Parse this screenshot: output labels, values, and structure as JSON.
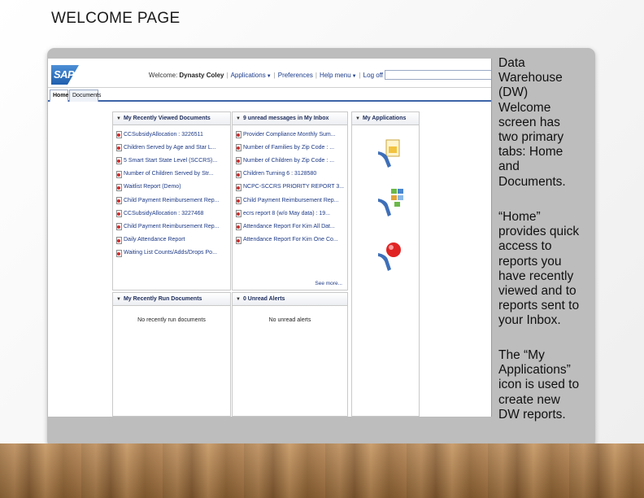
{
  "slide": {
    "title": "WELCOME PAGE",
    "paragraphs": [
      [
        "Data",
        "Warehouse",
        "(DW)",
        "Welcome",
        "screen has",
        "two  primary",
        "tabs:  Home",
        "and",
        "Documents."
      ],
      [
        "“Home”",
        "provides quick",
        "access to",
        "reports you",
        "have recently",
        "viewed and to",
        "reports sent to",
        "your Inbox."
      ],
      [
        "The “My",
        "Applications”",
        "icon is used to",
        "create new",
        "DW  reports."
      ]
    ]
  },
  "app": {
    "logo_text": "SAP",
    "colors": {
      "logo_blue": "#1f5fad",
      "tab_accent": "#3e64a8",
      "link": "#1d3a86"
    },
    "header": {
      "welcome": "Welcome:",
      "user": "Dynasty Coley",
      "applications": "Applications",
      "preferences": "Preferences",
      "help": "Help menu",
      "logoff": "Log off"
    },
    "tabs": [
      {
        "label": "Home",
        "active": true
      },
      {
        "label": "Documents",
        "active": false
      }
    ],
    "panels": {
      "recently_viewed": {
        "title": "My Recently Viewed Documents",
        "items": [
          "CCSubsidyAllocation : 3226511",
          "Children Served by Age and Star L...",
          "5 Smart Start State Level (SCCRS)...",
          "Number of Children Served by Str...",
          "Waitlist Report (Demo)",
          "Child Payment Reimbursement Rep...",
          "CCSubsidyAllocation : 3227468",
          "Child Payment Reimbursement Rep...",
          "Daily Attendance Report",
          "Waiting List Counts/Adds/Drops Po..."
        ]
      },
      "inbox": {
        "title": "9 unread messages in My Inbox",
        "items": [
          "Provider Compliance Monthly Sum...",
          "Number of Families by Zip Code : ...",
          "Number of Children by Zip Code : ...",
          "Children Turning 6 : 3128580",
          "NCPC-SCCRS PRIORITY REPORT 3...",
          "Child Payment Reimbursement Rep...",
          "ecrs report 8 (w/o May data) : 19...",
          "Attendance Report For Kim All Dat...",
          "Attendance Report For Kim One Co..."
        ],
        "see_more": "See more..."
      },
      "applications": {
        "title": "My Applications",
        "icons": [
          "web-intelligence-app-icon",
          "dashboard-app-icon",
          "explorer-app-icon"
        ]
      },
      "recently_run": {
        "title": "My Recently Run Documents",
        "empty": "No recently run documents"
      },
      "alerts": {
        "title": "0 Unread Alerts",
        "empty": "No unread alerts"
      }
    }
  }
}
